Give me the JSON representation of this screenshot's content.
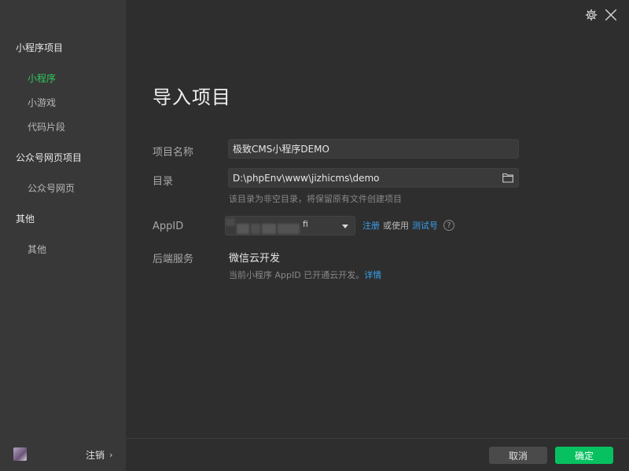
{
  "sidebar": {
    "groups": [
      {
        "label": "小程序项目",
        "items": [
          "小程序",
          "小游戏",
          "代码片段"
        ]
      },
      {
        "label": "公众号网页项目",
        "items": [
          "公众号网页"
        ]
      },
      {
        "label": "其他",
        "items": [
          "其他"
        ]
      }
    ],
    "active_item": "小程序",
    "logout_label": "注销",
    "logout_chevron": "›"
  },
  "main": {
    "title": "导入项目",
    "project_name": {
      "label": "项目名称",
      "value": "极致CMS小程序DEMO"
    },
    "directory": {
      "label": "目录",
      "value": "D:\\phpEnv\\www\\jizhicms\\demo",
      "hint": "该目录为非空目录，将保留原有文件创建项目"
    },
    "appid": {
      "label": "AppID",
      "visible_suffix": "fi",
      "register_label": "注册",
      "or_use_label": "或使用",
      "test_label": "测试号",
      "help_glyph": "?"
    },
    "backend": {
      "label": "后端服务",
      "value": "微信云开发",
      "hint": "当前小程序 AppID 已开通云开发。",
      "hint_link": "详情"
    }
  },
  "footer": {
    "cancel_label": "取消",
    "ok_label": "确定"
  },
  "icons": {
    "settings": "gear-icon",
    "close": "close-icon",
    "folder": "folder-icon"
  },
  "colors": {
    "accent_green": "#2fc75f",
    "confirm_button": "#07c160",
    "link_blue": "#39a1ee",
    "sidebar_bg": "#383838",
    "main_bg": "#2e2e2e"
  }
}
